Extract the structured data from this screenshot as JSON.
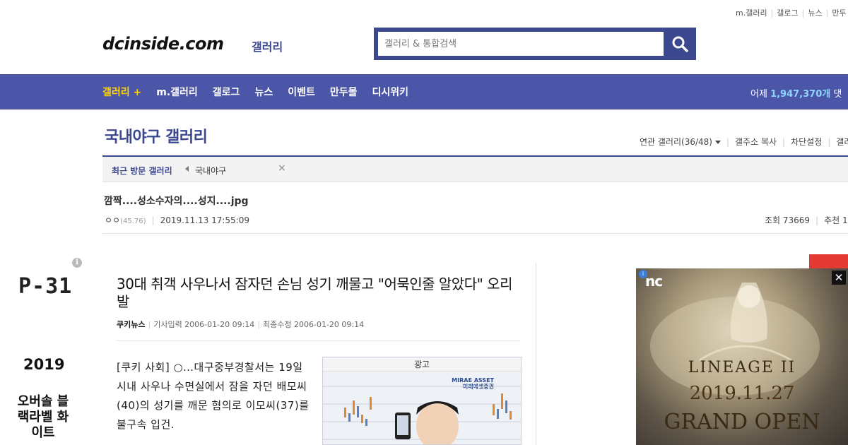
{
  "util_links": [
    "m.갤러리",
    "갤로그",
    "뉴스",
    "만두"
  ],
  "header": {
    "logo": "dcinside.com",
    "logo_sub": "갤러리",
    "search_placeholder": "갤러리 & 통합검색"
  },
  "gnb": {
    "items": [
      "갤러리 +",
      "m.갤러리",
      "갤로그",
      "뉴스",
      "이벤트",
      "만두몰",
      "디시위키"
    ],
    "stat_label": "어제",
    "stat_value": "1,947,370개",
    "stat_suffix": "댓"
  },
  "gallery": {
    "title": "국내야구 갤러리",
    "related": "연관 갤러리(36/48)",
    "copy_addr": "갤주소 복사",
    "block_settings": "차단설정",
    "more": "갤러"
  },
  "recent": {
    "label": "최근 방문 갤러리",
    "item": "국내야구",
    "close": "×"
  },
  "post": {
    "title": "깜짝....성소수자의....성지....jpg",
    "author": "ㅇㅇ",
    "ip": "(45.76)",
    "datetime": "2019.11.13 17:55:09",
    "views": "조회 73669",
    "recommend": "추천 1"
  },
  "ad_left": {
    "info": "i",
    "model": "P-31",
    "year": "2019",
    "name": "오버솔 블랙라벨 화이트"
  },
  "article": {
    "headline": "30대 취객 사우나서 잠자던 손님 성기 깨물고 \"어묵인줄 알았다\" 오리발",
    "source": "쿠키뉴스",
    "input_time": "기사입력 2006-01-20 09:14",
    "edit_time": "최종수정 2006-01-20 09:14",
    "body": "[쿠키 사회] ○…대구중부경찰서는 19일 시내 사우나 수면실에서 잠을 자던 배모씨(40)의 성기를 깨문 혐의로 이모씨(37)를 불구속 입건.",
    "ad_label": "광고",
    "ad_brand": "MIRAE ASSET",
    "ad_brand_sub": "미래에셋증권"
  },
  "ad_right": {
    "badge": "i",
    "logo": "nc",
    "game": "LINEAGE II",
    "date": "2019.11.27",
    "cta": "GRAND OPEN",
    "close": "✕"
  },
  "colors": {
    "nav_bg": "#4c56a8",
    "brand": "#3b4890",
    "active_nav": "#ffd600"
  }
}
